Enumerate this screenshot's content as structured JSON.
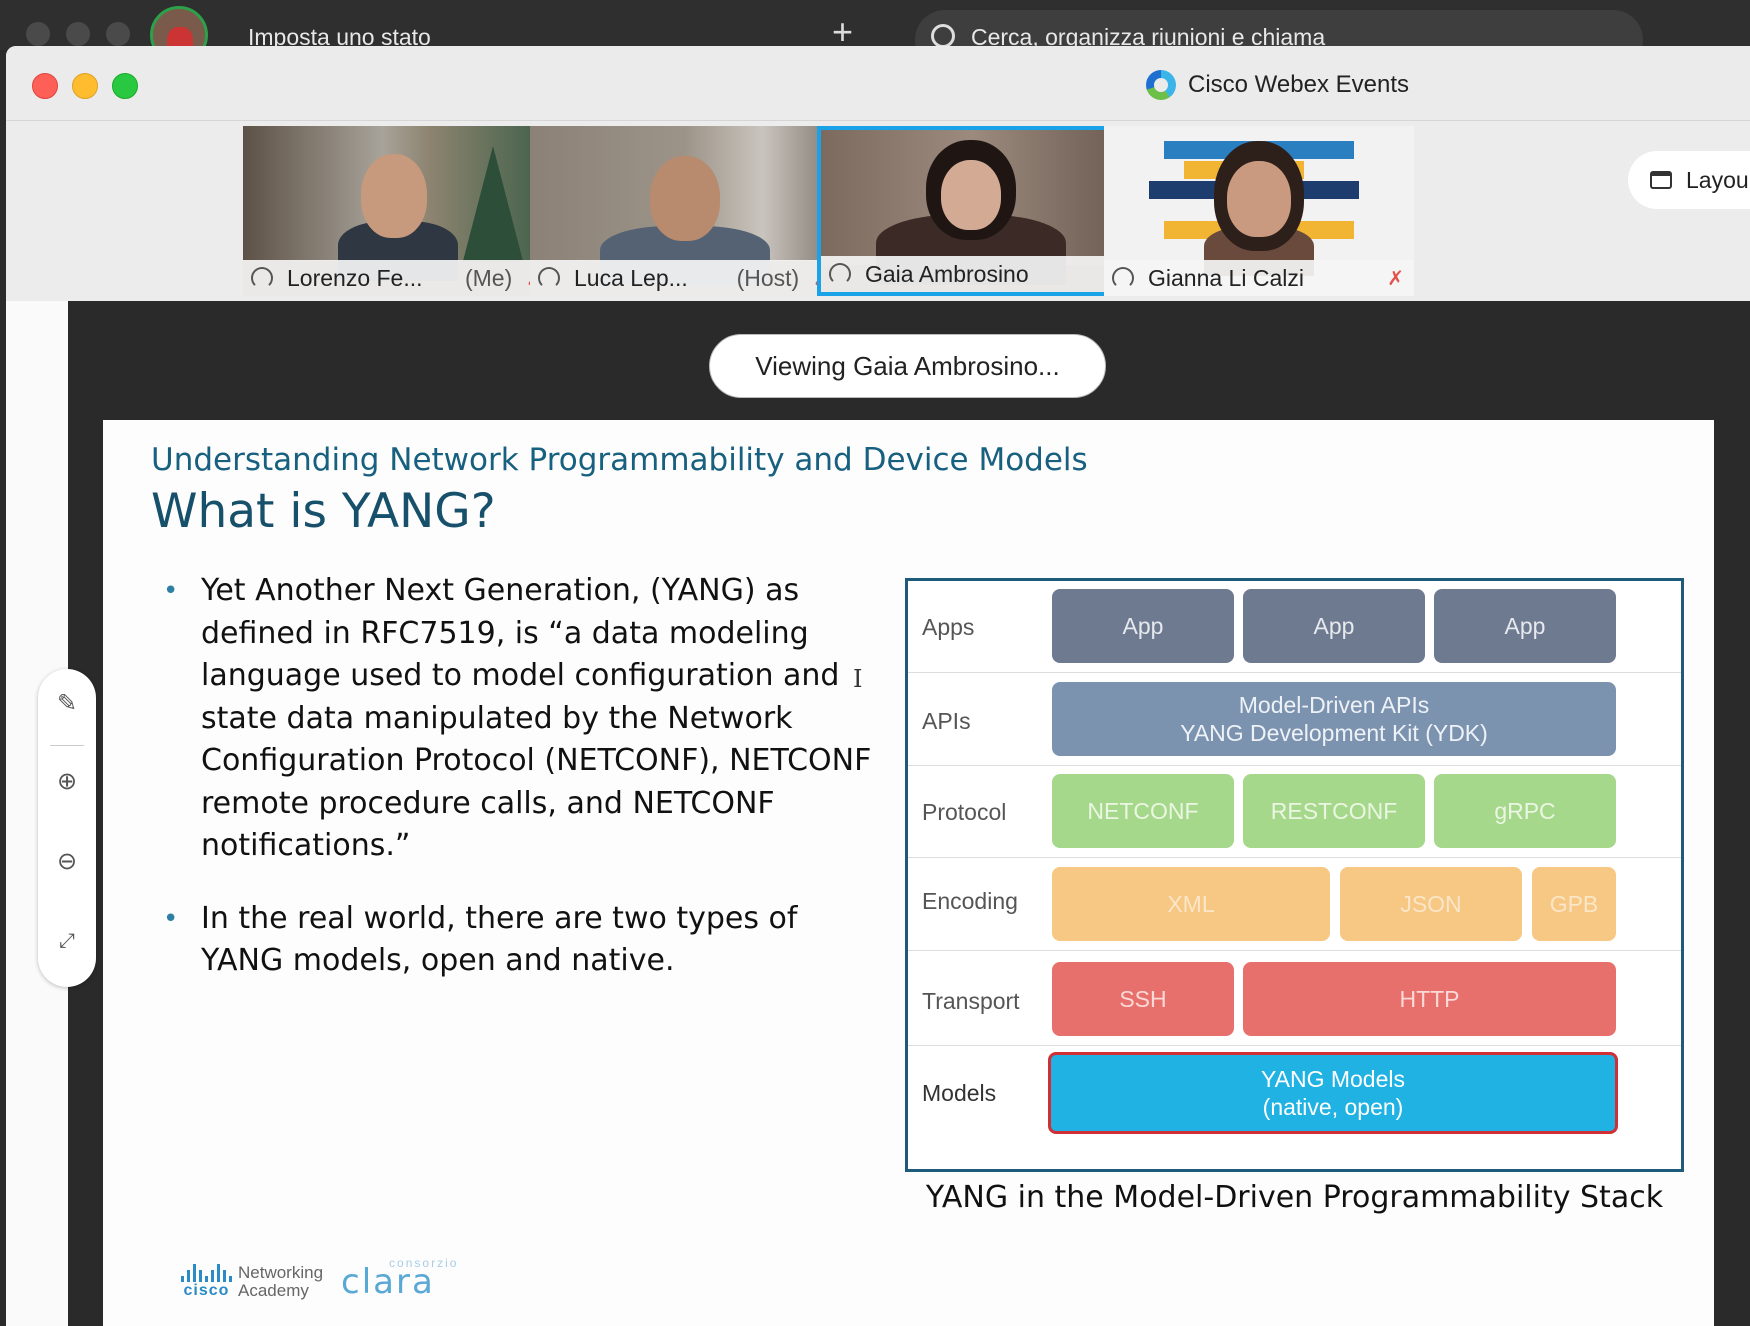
{
  "backbar": {
    "status_text": "Imposta uno stato",
    "plus_icon": "+",
    "search_placeholder": "Cerca, organizza riunioni e chiama"
  },
  "window": {
    "title": "Cisco Webex Events"
  },
  "participants": [
    {
      "name": "Lorenzo Fe...",
      "role": "(Me)",
      "muted": true
    },
    {
      "name": "Luca Lep...",
      "role": "(Host)",
      "muted": true
    },
    {
      "name": "Gaia Ambrosino",
      "role": "",
      "muted": false,
      "active_speaker": true
    },
    {
      "name": "Gianna Li Calzi",
      "role": "",
      "muted": true
    }
  ],
  "layout_button": {
    "label": "Layou"
  },
  "viewing_banner": "Viewing Gaia Ambrosino...",
  "slide": {
    "subtitle": "Understanding Network Programmability and Device Models",
    "title": "What is YANG?",
    "bullets": [
      "Yet Another Next Generation, (YANG) as defined in RFC7519, is “a data modeling language used to model configuration and state data manipulated by the Network Configuration Protocol (NETCONF), NETCONF remote procedure calls, and NETCONF notifications.”",
      "In the real world, there are two types of YANG models, open and native."
    ],
    "stack": {
      "rows": {
        "apps": {
          "label": "Apps",
          "blocks": [
            "App",
            "App",
            "App"
          ]
        },
        "apis": {
          "label": "APIs",
          "line1": "Model-Driven APIs",
          "line2": "YANG Development Kit (YDK)"
        },
        "protocol": {
          "label": "Protocol",
          "blocks": [
            "NETCONF",
            "RESTCONF",
            "gRPC"
          ]
        },
        "encoding": {
          "label": "Encoding",
          "blocks": [
            "XML",
            "JSON",
            "GPB"
          ]
        },
        "transport": {
          "label": "Transport",
          "blocks": [
            "SSH",
            "HTTP"
          ]
        },
        "models": {
          "label": "Models",
          "line1": "YANG Models",
          "line2": "(native, open)"
        }
      }
    },
    "caption": "YANG in the Model-Driven Programmability Stack",
    "footer": {
      "cisco_word": "cisco",
      "networking": "Networking",
      "academy": "Academy",
      "consorzio_word": "consorzio",
      "clara_word": "clara"
    }
  },
  "colors": {
    "active_border": "#1aa2e8",
    "title_blue": "#17506b",
    "app": "#6e7a90",
    "api": "#7c93b0",
    "protocol": "#a6d88b",
    "encoding": "#f7c784",
    "transport": "#e8706c",
    "yang": "#1fb2e3"
  },
  "icons": [
    "headset-icon",
    "mute-icon",
    "calendar-icon",
    "annotate-icon",
    "zoom-in-icon",
    "zoom-out-icon",
    "fit-screen-icon",
    "text-cursor-icon",
    "search-icon",
    "webex-logo-icon"
  ]
}
